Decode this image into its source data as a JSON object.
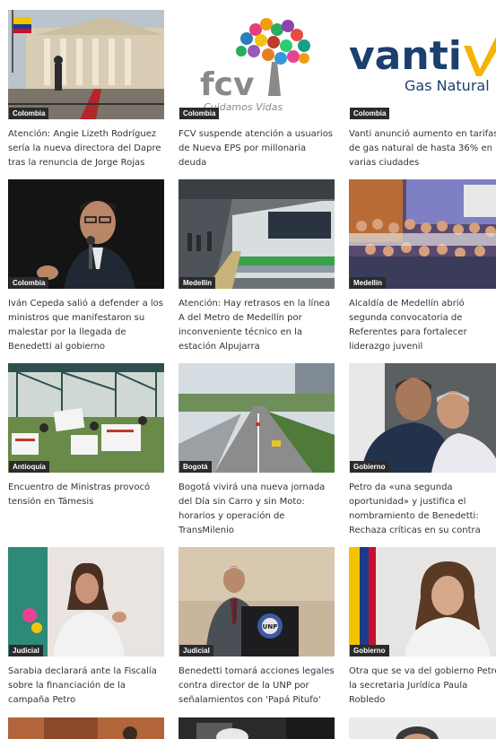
{
  "articles": [
    {
      "category": "Colombia",
      "title": "Atención: Angie Lizeth Rodríguez sería la nueva directora del Dapre tras la renuncia de Jorge Rojas"
    },
    {
      "category": "Colombia",
      "title": "FCV suspende atención a usuarios de Nueva EPS por millonaria deuda",
      "logo_text": "fcv",
      "logo_sub": "Cuidamos Vidas"
    },
    {
      "category": "Colombia",
      "title": "Vanti anunció aumento en tarifas de gas natural de hasta 36% en varias ciudades",
      "logo_text": "vanti",
      "logo_sub": "Gas Natural"
    },
    {
      "category": "Colombia",
      "title": "Iván Cepeda salió a defender a los ministros que manifestaron su malestar por la llegada de Benedetti al gobierno"
    },
    {
      "category": "Medellín",
      "title": "Atención: Hay retrasos en la línea A del Metro de Medellín por inconveniente técnico en la estación Alpujarra"
    },
    {
      "category": "Medellín",
      "title": "Alcaldía de Medellín abrió segunda convocatoria de Referentes para fortalecer liderazgo juvenil"
    },
    {
      "category": "Antioquia",
      "title": "Encuentro de Ministras provocó tensión en Támesis"
    },
    {
      "category": "Bogotá",
      "title": "Bogotá vivirá una nueva jornada del Día sin Carro y sin Moto: horarios y operación de TransMilenio"
    },
    {
      "category": "Gobierno",
      "title": "Petro da «una segunda oportunidad» y justifica el nombramiento de Benedetti: Rechaza críticas en su contra"
    },
    {
      "category": "Judicial",
      "title": "Sarabia declarará ante la Fiscalía sobre la financiación de la campaña Petro"
    },
    {
      "category": "Judicial",
      "title": "Benedetti tomará acciones legales contra director de la UNP por señalamientos con 'Papá Pitufo'",
      "logo_text": "UNP"
    },
    {
      "category": "Gobierno",
      "title": "Otra que se va del gobierno Petro, la secretaria Jurídica Paula Robledo"
    }
  ],
  "colors": {
    "badge_bg": "#2b2b2b",
    "text": "#333333",
    "vanti_blue": "#1c3f6e",
    "vanti_yellow": "#f5b400",
    "fcv_gray": "#8a8a8a"
  }
}
